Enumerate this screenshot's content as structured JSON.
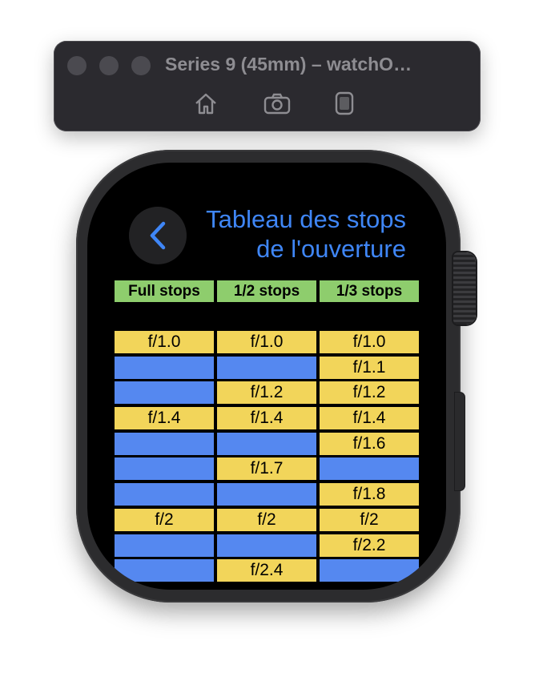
{
  "simulator": {
    "window_title": "Series 9 (45mm) – watchO…",
    "toolbar": [
      "home-icon",
      "screenshot-icon",
      "rotate-icon"
    ]
  },
  "app": {
    "title_line1": "Tableau des stops",
    "title_line2": "de l'ouverture",
    "accent_color": "#3f86f6"
  },
  "table": {
    "headers": [
      "Full stops",
      "1/2 stops",
      "1/3 stops"
    ],
    "rows": [
      [
        "f/1.0",
        "f/1.0",
        "f/1.0"
      ],
      [
        "",
        "",
        "f/1.1"
      ],
      [
        "",
        "f/1.2",
        "f/1.2"
      ],
      [
        "f/1.4",
        "f/1.4",
        "f/1.4"
      ],
      [
        "",
        "",
        "f/1.6"
      ],
      [
        "",
        "f/1.7",
        ""
      ],
      [
        "",
        "",
        "f/1.8"
      ],
      [
        "f/2",
        "f/2",
        "f/2"
      ],
      [
        "",
        "",
        "f/2.2"
      ],
      [
        "",
        "f/2.4",
        ""
      ]
    ],
    "colors": {
      "header": "#8ecd6d",
      "filled": "#f2d55a",
      "empty": "#5588f0"
    }
  }
}
